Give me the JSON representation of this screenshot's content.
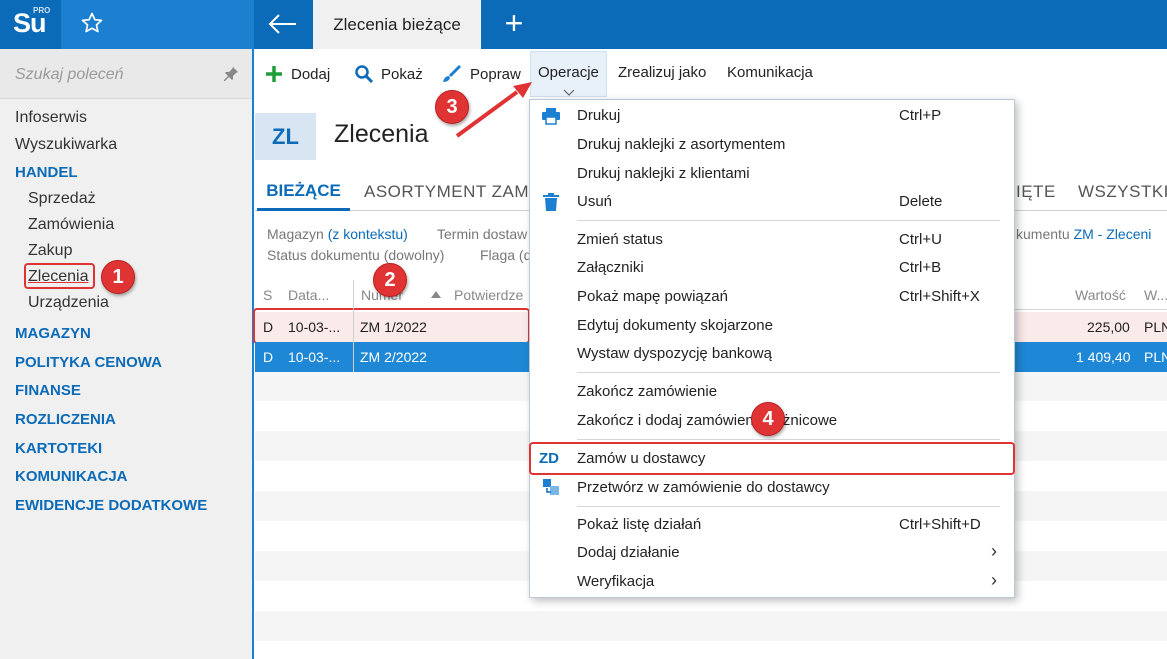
{
  "app": {
    "logo_text": "Su",
    "logo_sup": "PRO",
    "active_tab": "Zlecenia bieżące",
    "colors": {
      "primary": "#0b6bb8",
      "accent": "#1d7fd0",
      "callout": "#e03434",
      "selected_row": "#1e88d6"
    }
  },
  "sidebar": {
    "search_placeholder": "Szukaj poleceń",
    "items": [
      {
        "label": "Infoserwis"
      },
      {
        "label": "Wyszukiwarka"
      },
      {
        "label": "HANDEL"
      },
      {
        "label": "Sprzedaż"
      },
      {
        "label": "Zamówienia"
      },
      {
        "label": "Zakup"
      },
      {
        "label": "Zlecenia"
      },
      {
        "label": "Urządzenia"
      },
      {
        "label": "MAGAZYN"
      },
      {
        "label": "POLITYKA CENOWA"
      },
      {
        "label": "FINANSE"
      },
      {
        "label": "ROZLICZENIA"
      },
      {
        "label": "KARTOTEKI"
      },
      {
        "label": "KOMUNIKACJA"
      },
      {
        "label": "EWIDENCJE DODATKOWE"
      }
    ]
  },
  "toolbar": {
    "dodaj": "Dodaj",
    "pokaz": "Pokaż",
    "popraw": "Popraw",
    "operacje": "Operacje",
    "zrealizuj": "Zrealizuj jako",
    "komunikacja": "Komunikacja"
  },
  "header": {
    "badge": "ZL",
    "title": "Zlecenia"
  },
  "tabs": {
    "biezace": "BIEŻĄCE",
    "asortyment": "ASORTYMENT ZAMÓ",
    "partial": "IĘTE",
    "wszystkie": "WSZYSTKIE"
  },
  "filters": {
    "magazyn_label": "Magazyn",
    "magazyn_value": "(z kontekstu)",
    "termin_label": "Termin dostaw",
    "status_label": "Status dokumentu (dowolny)",
    "flaga_label": "Flaga (d",
    "dokument_label": "kumentu",
    "dokument_value": "ZM - Zleceni"
  },
  "grid": {
    "headers": {
      "s": "S",
      "data": "Data...",
      "numer": "Numer",
      "potw": "Potwierdze",
      "wartosc": "Wartość",
      "w": "W..."
    },
    "rows": [
      {
        "s": "D",
        "data": "10-03-...",
        "numer": "ZM 1/2022",
        "wartosc": "225,00",
        "waluta": "PLN"
      },
      {
        "s": "D",
        "data": "10-03-...",
        "numer": "ZM 2/2022",
        "wartosc": "1 409,40",
        "waluta": "PLN"
      }
    ]
  },
  "menu": {
    "items": [
      {
        "label": "Drukuj",
        "shortcut": "Ctrl+P"
      },
      {
        "label": "Drukuj naklejki z asortymentem"
      },
      {
        "label": "Drukuj naklejki z klientami"
      },
      {
        "label": "Usuń",
        "shortcut": "Delete"
      },
      {
        "label": "Zmień status",
        "shortcut": "Ctrl+U"
      },
      {
        "label": "Załączniki",
        "shortcut": "Ctrl+B"
      },
      {
        "label": "Pokaż mapę powiązań",
        "shortcut": "Ctrl+Shift+X"
      },
      {
        "label": "Edytuj dokumenty skojarzone"
      },
      {
        "label": "Wystaw dyspozycję bankową"
      },
      {
        "label": "Zakończ zamówienie"
      },
      {
        "label": "Zakończ i dodaj zamówienie różnicowe"
      },
      {
        "label": "Zamów u dostawcy",
        "icon_text": "ZD"
      },
      {
        "label": "Przetwórz w zamówienie do dostawcy"
      },
      {
        "label": "Pokaż listę działań",
        "shortcut": "Ctrl+Shift+D"
      },
      {
        "label": "Dodaj działanie",
        "arrow": "›"
      },
      {
        "label": "Weryfikacja",
        "arrow": "›"
      }
    ]
  },
  "callouts": [
    "1",
    "2",
    "3",
    "4"
  ]
}
